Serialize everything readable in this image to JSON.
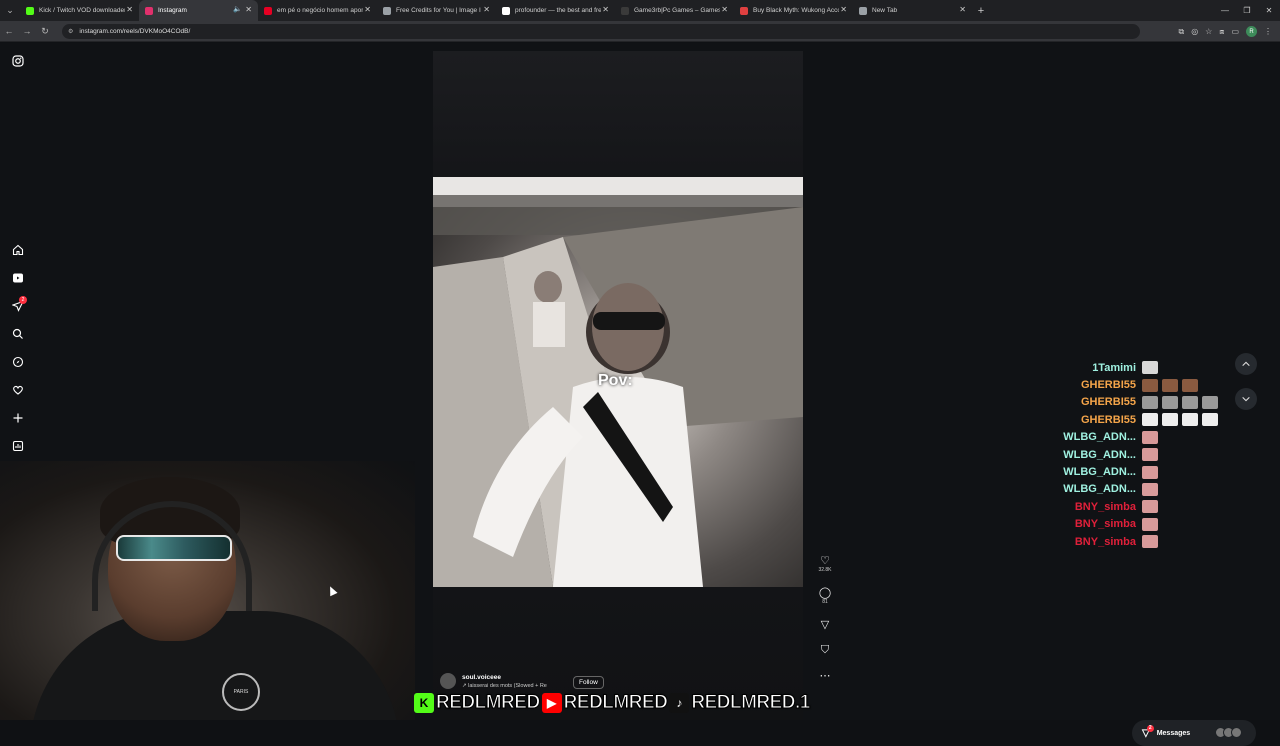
{
  "browser": {
    "tabs": [
      {
        "label": "Kick / Twitch VOD downloader",
        "color": "#53fc18",
        "active": false
      },
      {
        "label": "Instagram",
        "color": "#e1306c",
        "active": true
      },
      {
        "label": "em pé o negócio homem apon",
        "color": "#e60023",
        "active": false
      },
      {
        "label": "Free Credits for You | Image I",
        "color": "#9aa0a6",
        "active": false
      },
      {
        "label": "profounder — the best and fre",
        "color": "#ffffff",
        "active": false
      },
      {
        "label": "Game3rb|Pc Games – Games O",
        "color": "#3a3a3a",
        "active": false
      },
      {
        "label": "Buy Black Myth: Wukong Acco",
        "color": "#e04040",
        "active": false
      },
      {
        "label": "New Tab",
        "color": "#9aa0a6",
        "active": false
      }
    ],
    "url": "instagram.com/reels/DVKMoO4COdB/",
    "profile_initial": "R"
  },
  "reel": {
    "overlay_text": "Pov:",
    "likes": "32.8K",
    "comments": "81",
    "author": "soul.voiceee",
    "song": "laisserai des mots (Slowed + Re",
    "follow_label": "Follow"
  },
  "sidebar": {
    "notification_badge": "2"
  },
  "chat": [
    {
      "name": "1Tamimi",
      "color": "#9ff0e0",
      "emotes": [
        "#d8d8d8"
      ]
    },
    {
      "name": "GHERBI55",
      "color": "#f5a54a",
      "emotes": [
        "#8a5a40",
        "#8a5a40",
        "#8a5a40"
      ]
    },
    {
      "name": "GHERBI55",
      "color": "#f5a54a",
      "emotes": [
        "#9a9a9a",
        "#9a9a9a",
        "#9a9a9a",
        "#9a9a9a"
      ]
    },
    {
      "name": "GHERBI55",
      "color": "#f5a54a",
      "emotes": [
        "#eeeeee",
        "#eeeeee",
        "#eeeeee",
        "#eeeeee"
      ]
    },
    {
      "name": "WLBG_ADN...",
      "color": "#9ff0e0",
      "emotes": [
        "#d89a9a"
      ]
    },
    {
      "name": "WLBG_ADN...",
      "color": "#9ff0e0",
      "emotes": [
        "#d89a9a"
      ]
    },
    {
      "name": "WLBG_ADN...",
      "color": "#9ff0e0",
      "emotes": [
        "#d89a9a"
      ]
    },
    {
      "name": "WLBG_ADN...",
      "color": "#9ff0e0",
      "emotes": [
        "#d89a9a"
      ]
    },
    {
      "name": "BNY_simba",
      "color": "#e0203a",
      "emotes": [
        "#d89a9a"
      ]
    },
    {
      "name": "BNY_simba",
      "color": "#e0203a",
      "emotes": [
        "#d89a9a"
      ]
    },
    {
      "name": "BNY_simba",
      "color": "#e0203a",
      "emotes": [
        "#d89a9a"
      ]
    }
  ],
  "banner": [
    {
      "logo": "K",
      "logo_color": "#53fc18",
      "text": "REDLMRED"
    },
    {
      "logo": "▶",
      "logo_color": "#ff0000",
      "text": "REDLMRED"
    },
    {
      "logo": "♪",
      "logo_color": "#111111",
      "text": "REDLMRED.1"
    }
  ],
  "webcam": {
    "jersey_text": "PARIS"
  },
  "messages": {
    "label": "Messages",
    "badge": "2"
  }
}
